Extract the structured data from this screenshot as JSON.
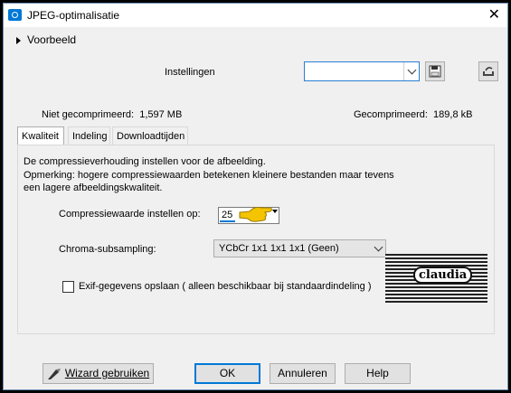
{
  "window": {
    "title": "JPEG-optimalisatie",
    "close_glyph": "✕"
  },
  "preview": {
    "label": "Voorbeeld"
  },
  "settings": {
    "label": "Instellingen",
    "preset_value": ""
  },
  "sizes": {
    "uncompressed_label": "Niet gecomprimeerd:",
    "uncompressed_value": "1,597 MB",
    "compressed_label": "Gecomprimeerd:",
    "compressed_value": "189,8 kB"
  },
  "tabs": [
    {
      "label": "Kwaliteit"
    },
    {
      "label": "Indeling"
    },
    {
      "label": "Downloadtijden"
    }
  ],
  "quality": {
    "description": "De compressieverhouding instellen voor de afbeelding.",
    "note_line1": "Opmerking:  hogere compressiewaarden betekenen kleinere bestanden maar tevens",
    "note_line2": "een lagere afbeeldingskwaliteit.",
    "compression_label": "Compressiewaarde instellen op:",
    "compression_value": "25",
    "compression_progress": 0.25,
    "chroma_label": "Chroma-subsampling:",
    "chroma_value": "YCbCr  1x1  1x1  1x1  (Geen)",
    "exif_label": "Exif-gegevens opslaan ( alleen beschikbaar bij standaardindeling )",
    "exif_checked": false
  },
  "watermark": {
    "text": "claudia"
  },
  "buttons": {
    "wizard": "Wizard gebruiken",
    "ok": "OK",
    "cancel": "Annuleren",
    "help": "Help"
  },
  "colors": {
    "accent": "#0078d7",
    "hand": "#f4c400"
  }
}
